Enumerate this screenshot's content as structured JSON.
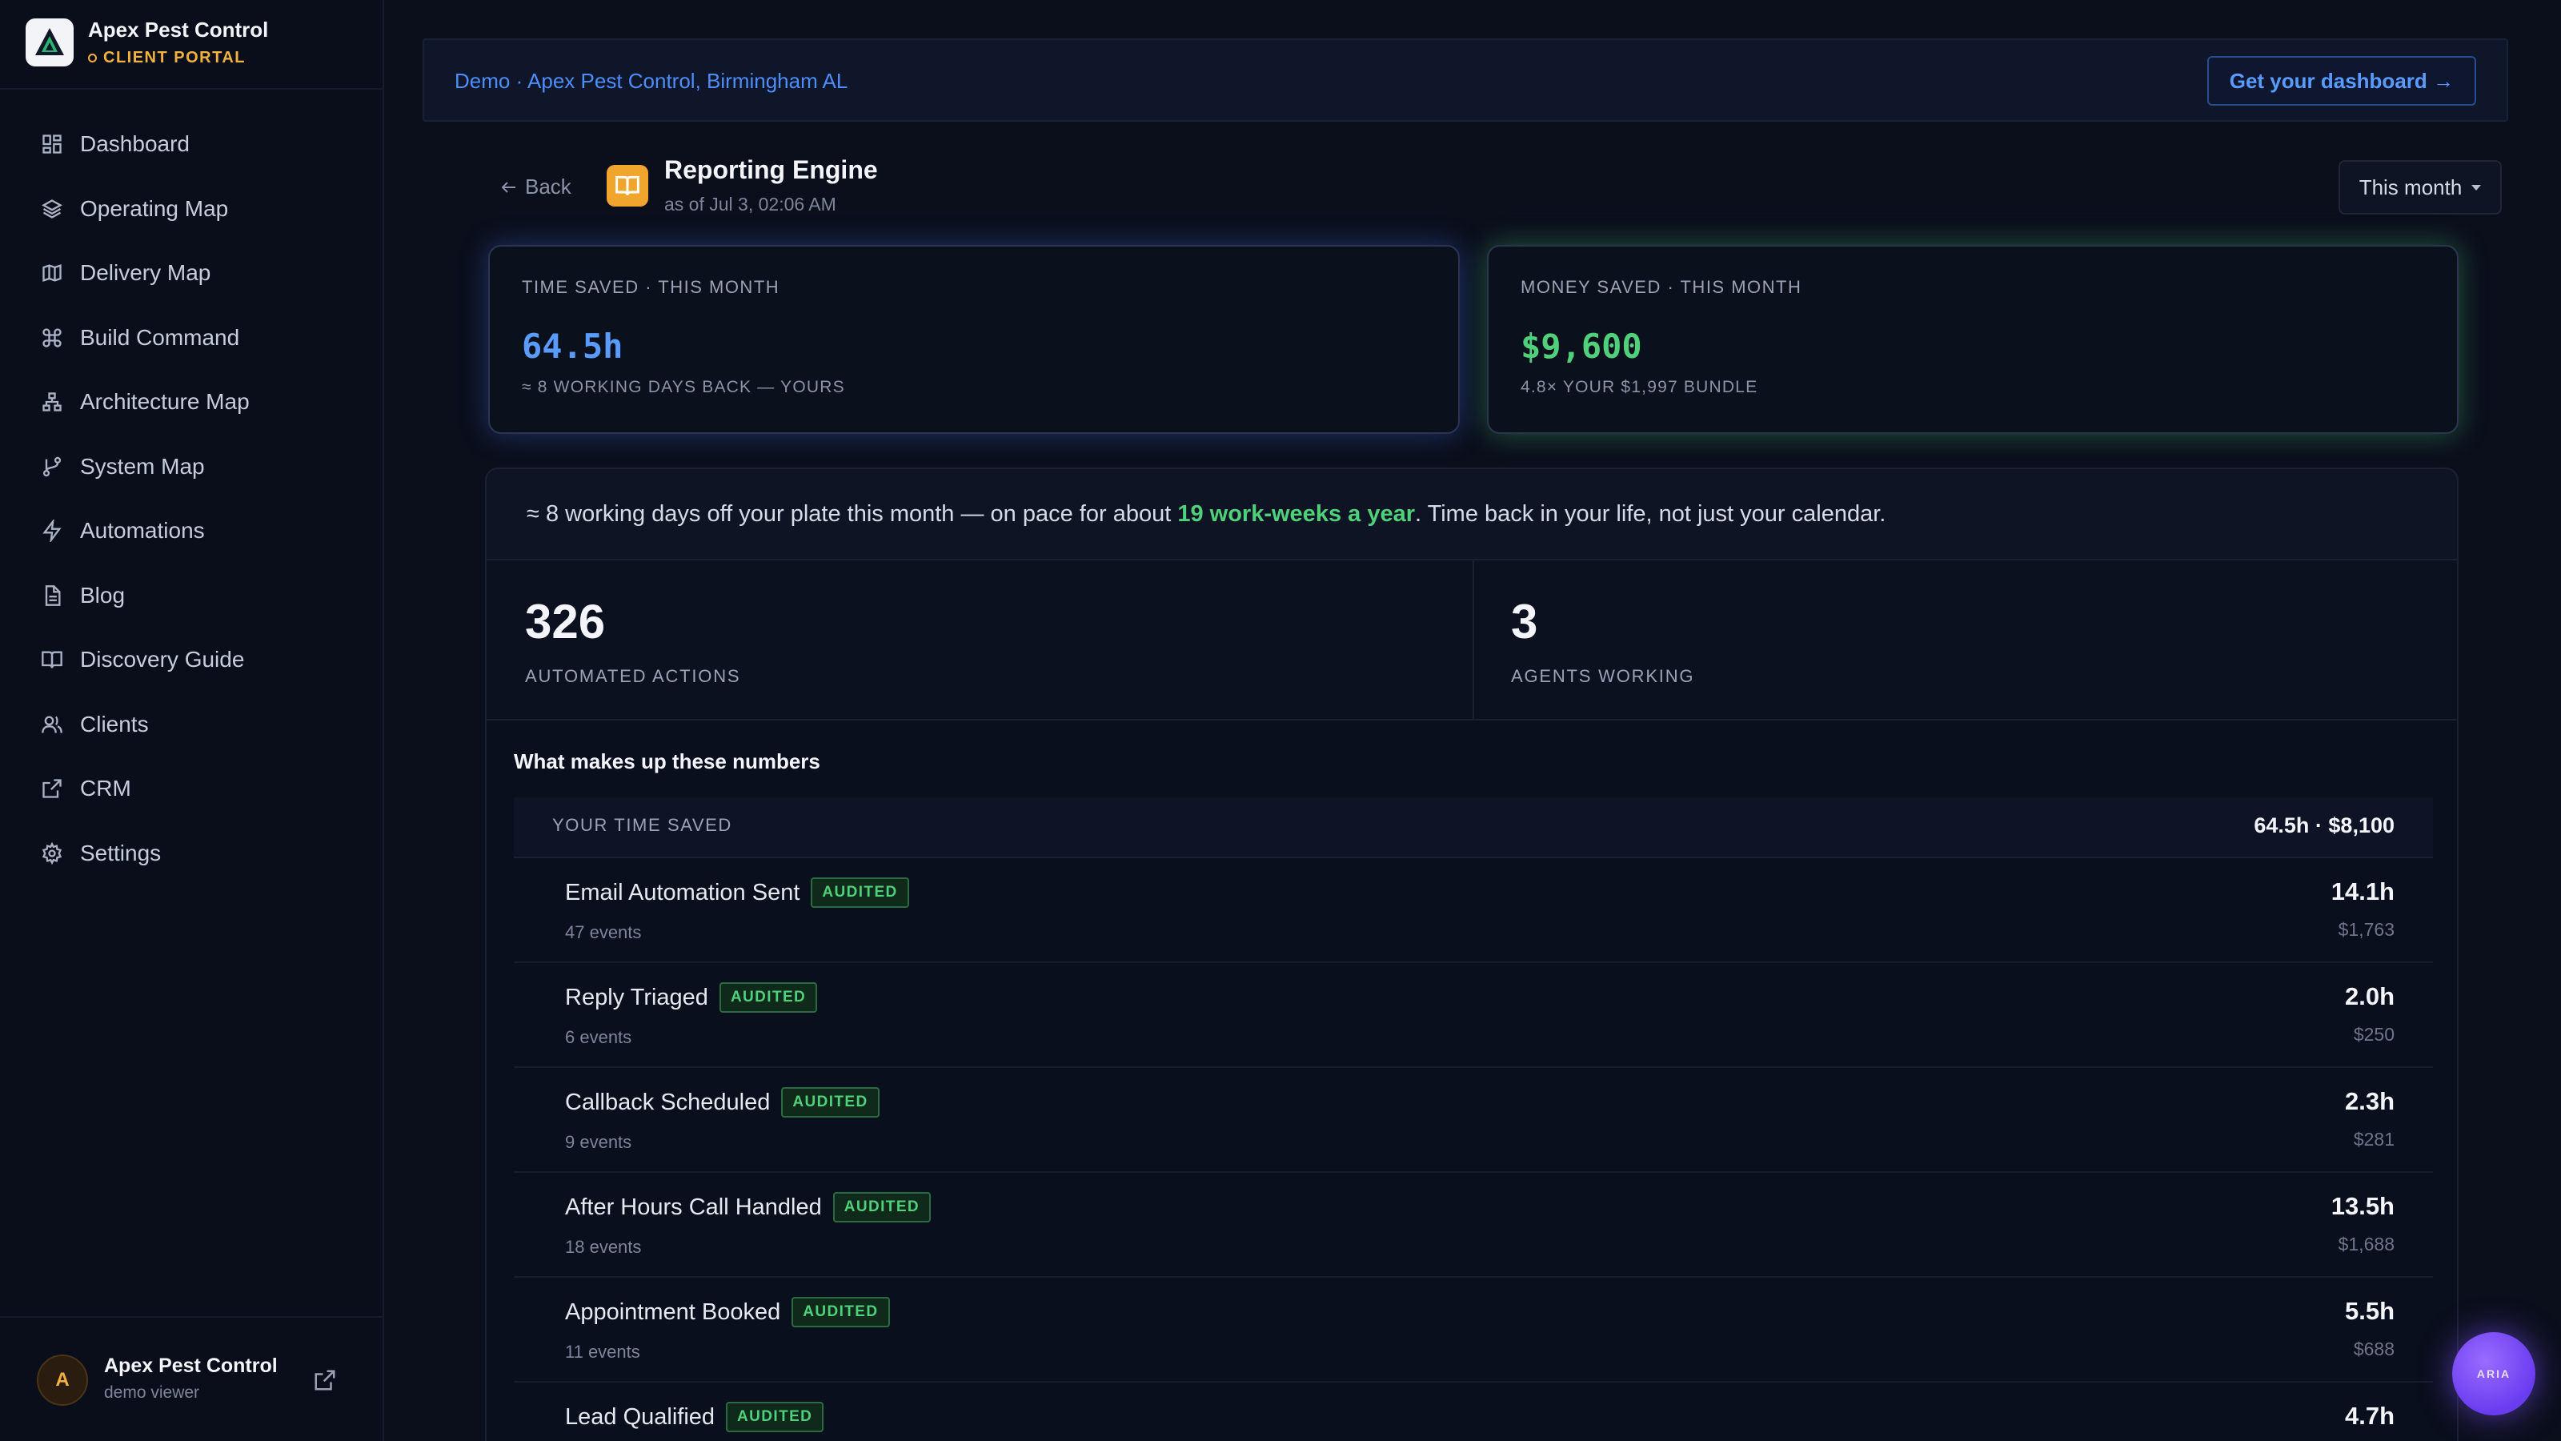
{
  "brand": {
    "name": "Apex Pest Control",
    "subtitle": "CLIENT PORTAL"
  },
  "sidebar": {
    "items": [
      {
        "label": "Dashboard",
        "icon": "grid-icon"
      },
      {
        "label": "Operating Map",
        "icon": "layers-icon"
      },
      {
        "label": "Delivery Map",
        "icon": "map-icon"
      },
      {
        "label": "Build Command",
        "icon": "command-icon"
      },
      {
        "label": "Architecture Map",
        "icon": "network-icon"
      },
      {
        "label": "System Map",
        "icon": "git-branch-icon"
      },
      {
        "label": "Automations",
        "icon": "bolt-icon"
      },
      {
        "label": "Blog",
        "icon": "document-icon"
      },
      {
        "label": "Discovery Guide",
        "icon": "book-icon"
      },
      {
        "label": "Clients",
        "icon": "users-icon"
      },
      {
        "label": "CRM",
        "icon": "external-link-icon"
      },
      {
        "label": "Settings",
        "icon": "gear-icon"
      }
    ]
  },
  "footer": {
    "avatar_initial": "A",
    "name": "Apex Pest Control",
    "role": "demo viewer"
  },
  "demo_bar": {
    "text": "Demo · Apex Pest Control, Birmingham AL",
    "cta": "Get your dashboard →"
  },
  "header": {
    "back": "Back",
    "title": "Reporting Engine",
    "as_of": "as of Jul 3, 02:06 AM",
    "period": "This month"
  },
  "cards": {
    "time": {
      "label": "TIME SAVED · THIS MONTH",
      "value": "64.5h",
      "sub": "≈ 8 WORKING DAYS BACK — YOURS"
    },
    "money": {
      "label": "MONEY SAVED · THIS MONTH",
      "value": "$9,600",
      "sub": "4.8× YOUR $1,997 BUNDLE"
    }
  },
  "banner": {
    "prefix": "≈ 8 working days off your plate this month — on pace for about ",
    "highlight": "19 work-weeks a year",
    "suffix": ". Time back in your life, not just your calendar."
  },
  "stats": {
    "actions": {
      "value": "326",
      "label": "AUTOMATED ACTIONS"
    },
    "agents": {
      "value": "3",
      "label": "AGENTS WORKING"
    }
  },
  "breakdown": {
    "title": "What makes up these numbers",
    "section_label": "YOUR TIME SAVED",
    "section_total": "64.5h · $8,100",
    "rows": [
      {
        "name": "Email Automation Sent",
        "badge": "AUDITED",
        "events": "47 events",
        "hours": "14.1h",
        "money": "$1,763"
      },
      {
        "name": "Reply Triaged",
        "badge": "AUDITED",
        "events": "6 events",
        "hours": "2.0h",
        "money": "$250"
      },
      {
        "name": "Callback Scheduled",
        "badge": "AUDITED",
        "events": "9 events",
        "hours": "2.3h",
        "money": "$281"
      },
      {
        "name": "After Hours Call Handled",
        "badge": "AUDITED",
        "events": "18 events",
        "hours": "13.5h",
        "money": "$1,688"
      },
      {
        "name": "Appointment Booked",
        "badge": "AUDITED",
        "events": "11 events",
        "hours": "5.5h",
        "money": "$688"
      },
      {
        "name": "Lead Qualified",
        "badge": "AUDITED",
        "events": "",
        "hours": "4.7h",
        "money": ""
      }
    ]
  },
  "assistant": {
    "label": "ARIA"
  },
  "colors": {
    "accent_blue": "#5a9bff",
    "accent_green": "#4fd07a",
    "brand_amber": "#f3b23f"
  }
}
